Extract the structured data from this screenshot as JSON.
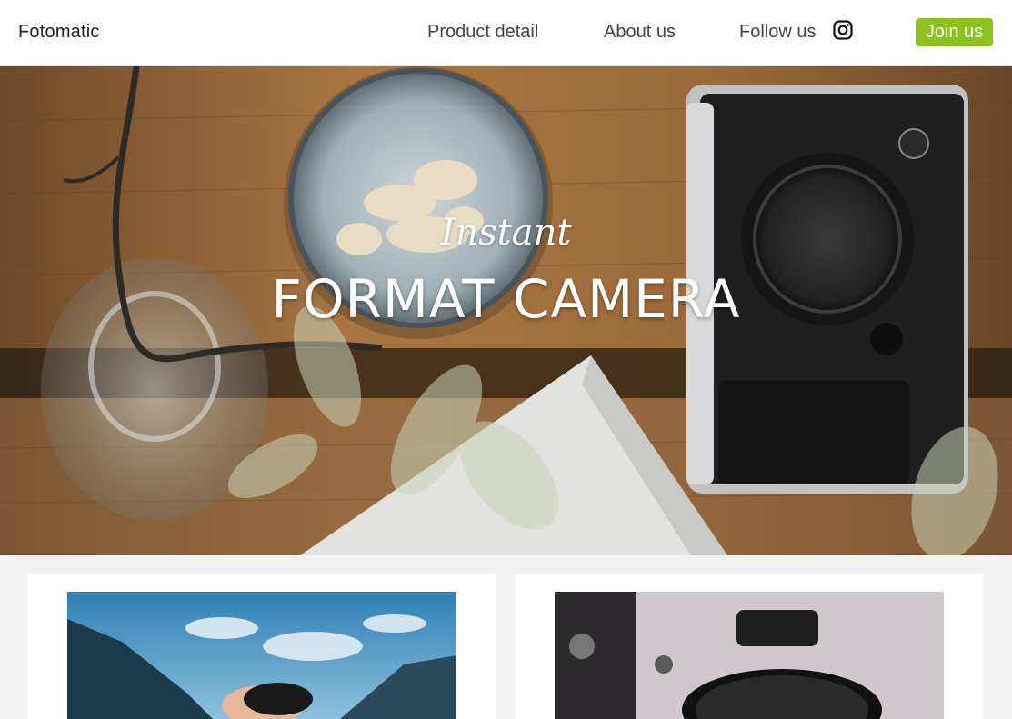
{
  "header": {
    "brand": "Fotomatic",
    "nav": {
      "product": "Product detail",
      "about": "About us",
      "follow": "Follow us"
    },
    "follow_icon": "instagram-icon",
    "join_label": "Join us"
  },
  "hero": {
    "script_text": "Instant",
    "title": "FORMAT CAMERA"
  },
  "cards": [
    {
      "image": "photo-hand-with-lens-mountains"
    },
    {
      "image": "photo-vintage-camera-closeup"
    }
  ],
  "colors": {
    "accent": "#8dc21f",
    "header_bg": "#ffffff",
    "page_bg": "#f2f2f2"
  }
}
